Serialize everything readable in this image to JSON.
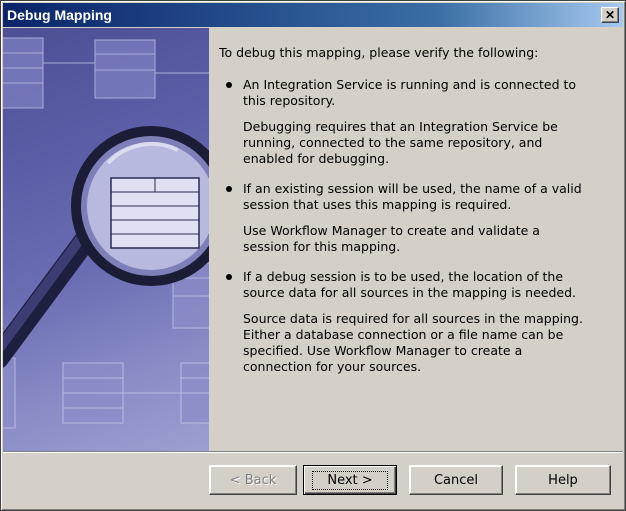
{
  "window": {
    "title": "Debug Mapping",
    "close_label": "✕"
  },
  "content": {
    "intro": "To debug this mapping, please verify the following:",
    "items": [
      {
        "bullet": "An Integration Service is running and is connected to this repository.",
        "detail": "Debugging requires that an Integration Service be running, connected to the same repository, and enabled for debugging."
      },
      {
        "bullet": "If an existing session will be used, the name of a valid session that uses this mapping is required.",
        "detail": "Use Workflow Manager to create and validate a session for this mapping."
      },
      {
        "bullet": "If a debug session is to be used, the location of the source data for all sources in the mapping is needed.",
        "detail": "Source data is required for all sources in the mapping. Either a database connection or a file name can be specified. Use Workflow Manager to create a connection for your sources."
      }
    ]
  },
  "buttons": {
    "back": "< Back",
    "next": "Next >",
    "cancel": "Cancel",
    "help": "Help"
  },
  "colors": {
    "dialog_bg": "#d4d0c8",
    "titlebar_start": "#0a246a",
    "titlebar_end": "#a6caf0",
    "illustration": "#5b5ea6"
  }
}
